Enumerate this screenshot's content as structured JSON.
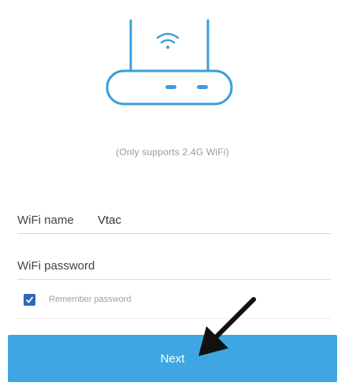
{
  "hint": {
    "text": "(Only supports 2.4G WiFi)"
  },
  "form": {
    "wifi_name": {
      "label": "WiFi name",
      "value": "Vtac"
    },
    "wifi_password": {
      "label": "WiFi password",
      "value": ""
    },
    "remember": {
      "label": "Remember password",
      "checked": true
    },
    "next_label": "Next"
  },
  "colors": {
    "accent": "#3ea7e3",
    "checkbox": "#2e67b8",
    "router_line": "#3d9ddb"
  },
  "icons": {
    "router": "router-icon",
    "wifi": "wifi-icon",
    "check": "check-icon",
    "arrow": "arrow-pointer-icon"
  }
}
